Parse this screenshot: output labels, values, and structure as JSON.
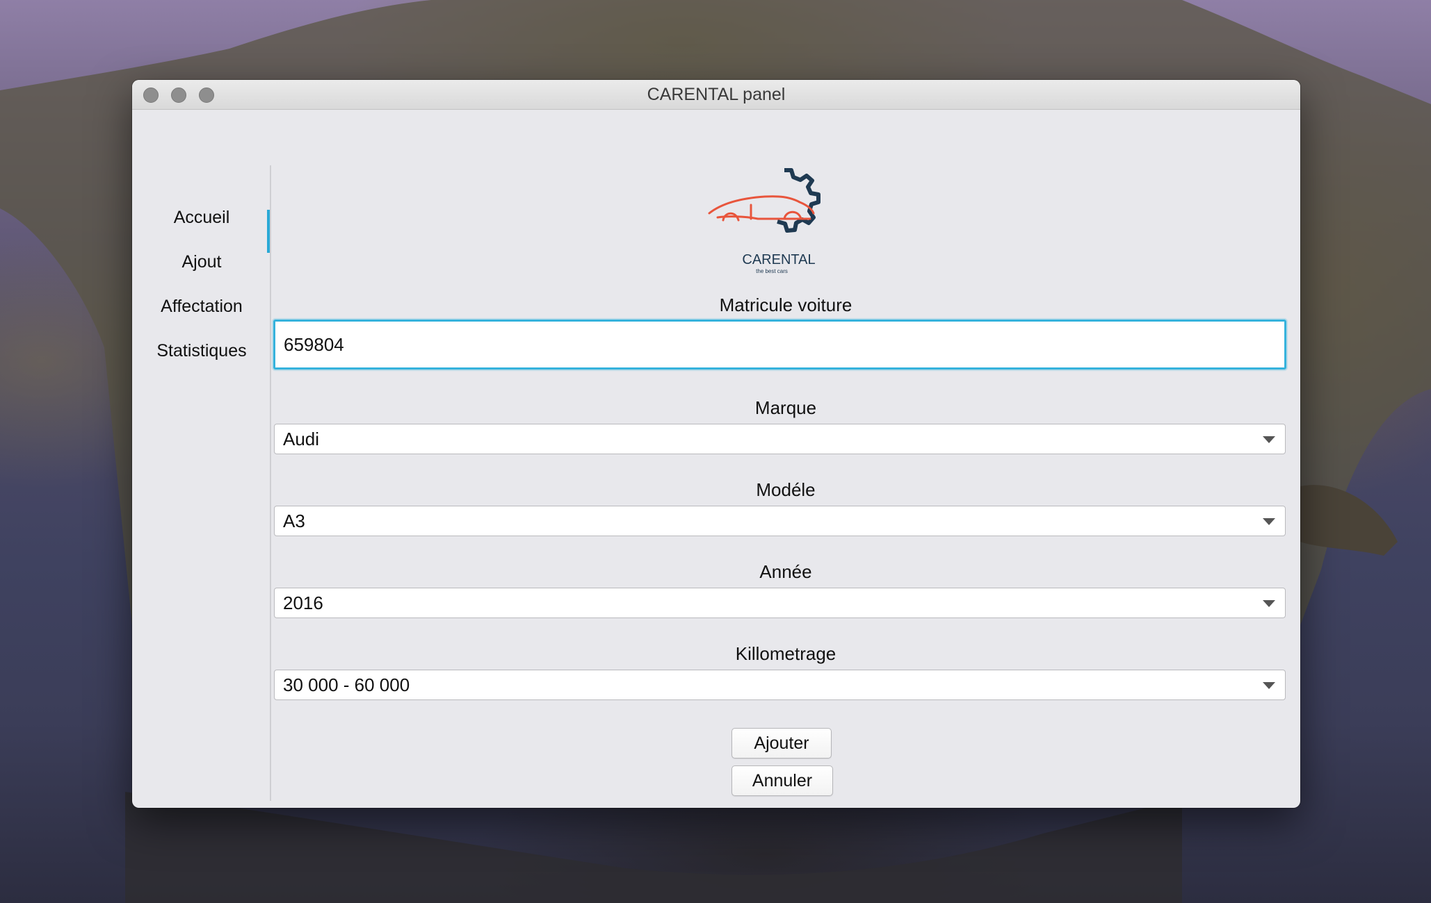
{
  "window": {
    "title": "CARENTAL panel"
  },
  "sidebar": {
    "items": [
      {
        "label": "Accueil"
      },
      {
        "label": "Ajout",
        "active": true
      },
      {
        "label": "Affectation"
      },
      {
        "label": "Statistiques"
      }
    ]
  },
  "logo": {
    "name": "CARENTAL",
    "tagline": "the best cars"
  },
  "form": {
    "matricule": {
      "label": "Matricule voiture",
      "value": "659804"
    },
    "marque": {
      "label": "Marque",
      "value": "Audi"
    },
    "modele": {
      "label": "Modéle",
      "value": "A3"
    },
    "annee": {
      "label": "Année",
      "value": "2016"
    },
    "kilometrage": {
      "label": "Killometrage",
      "value": "30 000 - 60 000"
    }
  },
  "buttons": {
    "add_label": "Ajouter",
    "cancel_label": "Annuler"
  },
  "colors": {
    "accent": "#2aa9d6",
    "logo_car": "#e8553c",
    "logo_gear": "#1f3a52"
  }
}
